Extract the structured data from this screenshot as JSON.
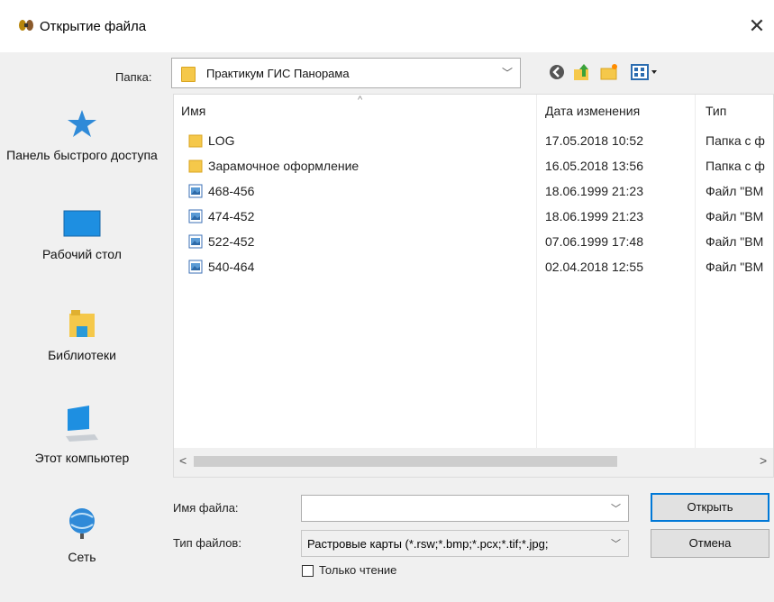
{
  "window": {
    "title": "Открытие файла",
    "close_glyph": "✕"
  },
  "folder": {
    "label": "Папка:",
    "value": "Практикум ГИС Панорама"
  },
  "toolbar": {
    "icons": [
      "back-icon",
      "up-folder-icon",
      "new-folder-icon",
      "view-menu-icon"
    ]
  },
  "places": [
    {
      "label": "Панель быстрого доступа",
      "icon": "star-icon"
    },
    {
      "label": "Рабочий стол",
      "icon": "desktop-icon"
    },
    {
      "label": "Библиотеки",
      "icon": "libraries-icon"
    },
    {
      "label": "Этот компьютер",
      "icon": "computer-icon"
    },
    {
      "label": "Сеть",
      "icon": "network-icon"
    }
  ],
  "file_list": {
    "headers": {
      "name": "Имя",
      "date": "Дата изменения",
      "type": "Тип"
    },
    "rows": [
      {
        "name": "LOG",
        "date": "17.05.2018 10:52",
        "type": "Папка с ф",
        "icon": "folder"
      },
      {
        "name": "Зарамочное оформление",
        "date": "16.05.2018 13:56",
        "type": "Папка с ф",
        "icon": "folder"
      },
      {
        "name": "468-456",
        "date": "18.06.1999 21:23",
        "type": "Файл \"BM",
        "icon": "bitmap"
      },
      {
        "name": "474-452",
        "date": "18.06.1999 21:23",
        "type": "Файл \"BM",
        "icon": "bitmap"
      },
      {
        "name": "522-452",
        "date": "07.06.1999 17:48",
        "type": "Файл \"BM",
        "icon": "bitmap"
      },
      {
        "name": "540-464",
        "date": "02.04.2018 12:55",
        "type": "Файл \"BM",
        "icon": "bitmap"
      }
    ]
  },
  "filename": {
    "label": "Имя файла:",
    "value": ""
  },
  "filetype": {
    "label": "Тип файлов:",
    "value": "Растровые карты (*.rsw;*.bmp;*.pcx;*.tif;*.jpg;"
  },
  "readonly": {
    "label": "Только чтение",
    "checked": false
  },
  "buttons": {
    "open": "Открыть",
    "cancel": "Отмена"
  }
}
